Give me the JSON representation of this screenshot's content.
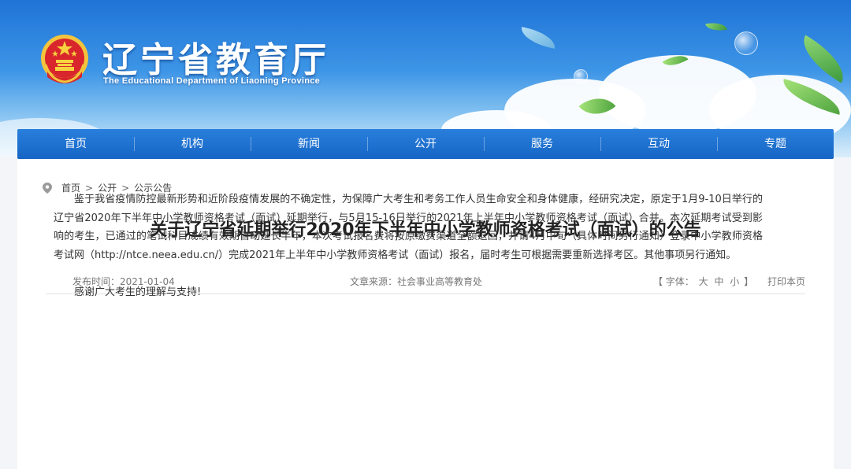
{
  "header": {
    "site_title": "辽宁省教育厅",
    "site_subtitle": "The Educational Department of Liaoning Province"
  },
  "nav": {
    "items": [
      {
        "label": "首页"
      },
      {
        "label": "机构"
      },
      {
        "label": "新闻"
      },
      {
        "label": "公开"
      },
      {
        "label": "服务"
      },
      {
        "label": "互动"
      },
      {
        "label": "专题"
      }
    ]
  },
  "breadcrumb": {
    "items": [
      "首页",
      "公开",
      "公示公告"
    ],
    "separator": ">"
  },
  "article": {
    "title": "关于辽宁省延期举行2020年下半年中小学教师资格考试（面试）的公告",
    "publish_time": "发布时间：2021-01-04",
    "source": "文章来源：社会事业高等教育处",
    "font_size_label": "【 字体：",
    "font_sizes": [
      "大",
      "中",
      "小"
    ],
    "font_size_close": "】",
    "print_label": "打印本页",
    "paragraph": "鉴于我省疫情防控最新形势和近阶段疫情发展的不确定性，为保障广大考生和考务工作人员生命安全和身体健康，经研究决定，原定于1月9-10日举行的辽宁省2020年下半年中小学教师资格考试（面试）延期举行，与5月15-16日举行的2021年上半年中小学教师资格考试（面试）合并。本次延期考试受到影响的考生，已通过的笔试科目成绩有效期自动延长半年，本次考试报名费将按原缴费渠道全额退回，并请4月中旬（具体时间另行通知）登录中小学教师资格考试网（http://ntce.neea.edu.cn/）完成2021年上半年中小学教师资格考试（面试）报名，届时考生可根据需要重新选择考区。其他事项另行通知。",
    "thanks": "感谢广大考生的理解与支持!"
  },
  "colors": {
    "nav_bg": "#1a6fd0",
    "title_text": "#222222",
    "banner_sky": "#2a80dc"
  },
  "icons": {
    "emblem": "national-emblem-icon",
    "location": "location-pin-icon"
  }
}
